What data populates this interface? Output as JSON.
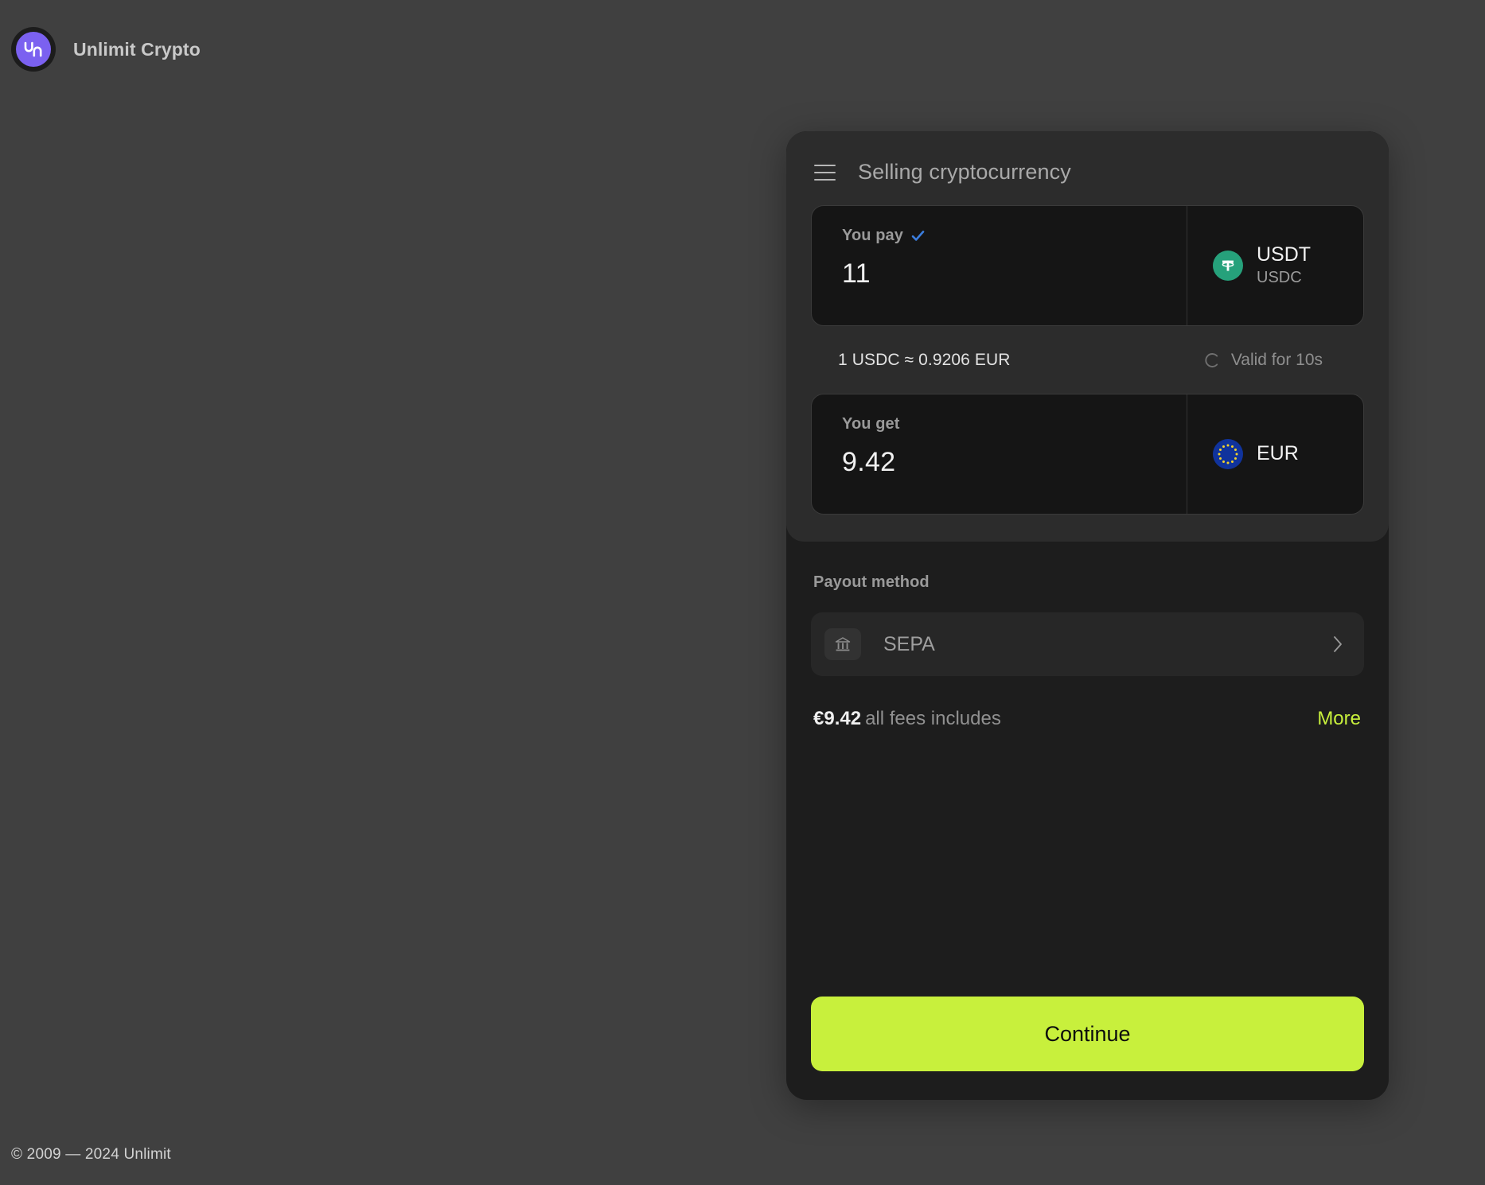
{
  "brand": {
    "name": "Unlimit Crypto",
    "logo_icon": "unlimit-logo-icon",
    "logo_color": "#7b61f0"
  },
  "footer": {
    "copyright": "© 2009 — 2024 Unlimit"
  },
  "card": {
    "menu_icon": "hamburger-menu-icon",
    "title": "Selling cryptocurrency",
    "pay": {
      "label": "You pay",
      "verified_icon": "check-icon",
      "verified_color": "#3b7ddd",
      "value": "11",
      "currency_icon": "usdt-icon",
      "currency_icon_color": "#26a17b",
      "currency_symbol": "₮",
      "currency_primary": "USDT",
      "currency_secondary": "USDC"
    },
    "rate": {
      "text": "1 USDC ≈ 0.9206 EUR",
      "timer_icon": "spinner-icon",
      "valid_text": "Valid for 10s"
    },
    "get": {
      "label": "You get",
      "value": "9.42",
      "currency_icon": "eu-flag-icon",
      "currency_icon_color": "#10339c",
      "currency_primary": "EUR"
    },
    "payout": {
      "section_label": "Payout method",
      "method_icon": "bank-icon",
      "method_name": "SEPA",
      "chevron_icon": "chevron-right-icon"
    },
    "fees": {
      "amount": "€9.42",
      "text": "all fees includes",
      "more_label": "More",
      "more_color": "#c8f03c"
    },
    "continue_label": "Continue",
    "continue_color": "#c8f03c"
  }
}
